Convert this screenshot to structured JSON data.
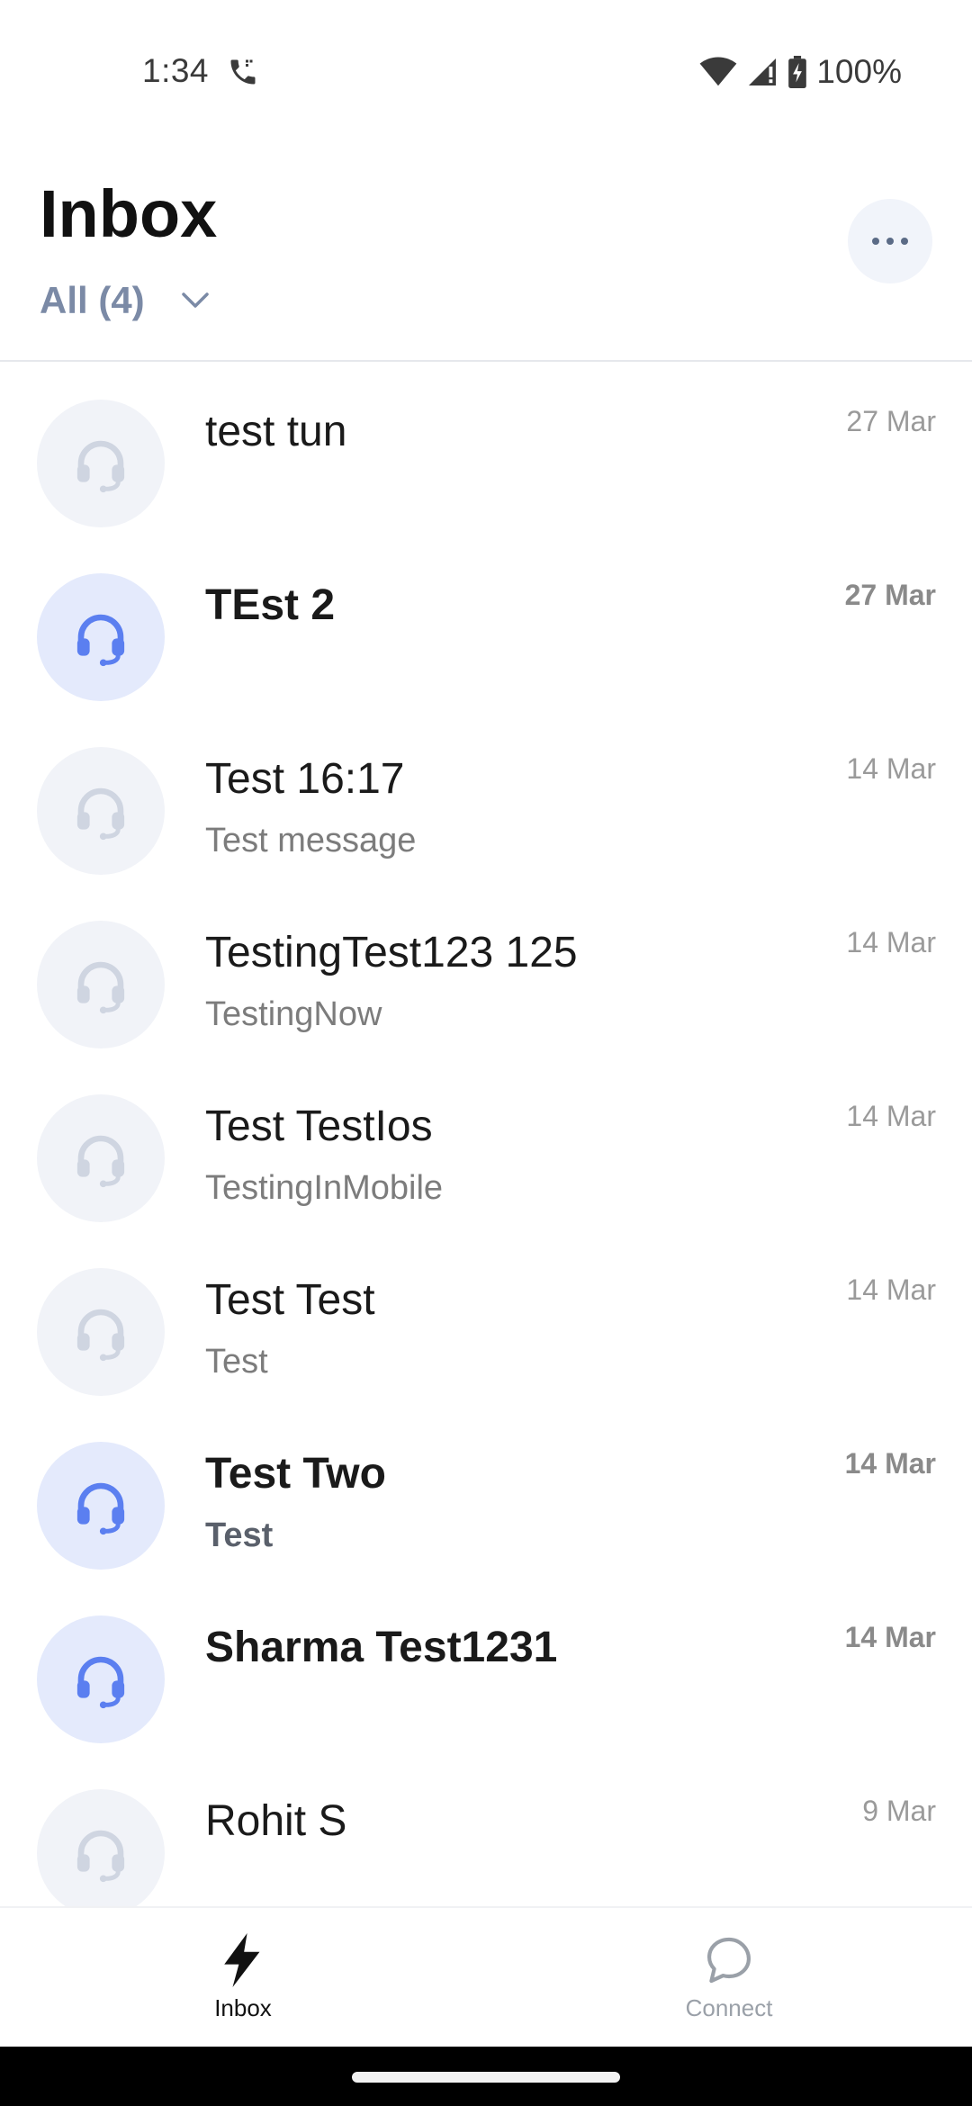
{
  "status_bar": {
    "time": "1:34",
    "battery": "100%"
  },
  "header": {
    "title": "Inbox",
    "filter_label": "All (4)"
  },
  "conversations": [
    {
      "name": "test tun",
      "preview": "",
      "date": "27 Mar",
      "unread": false
    },
    {
      "name": "TEst 2",
      "preview": "",
      "date": "27 Mar",
      "unread": true
    },
    {
      "name": "Test 16:17",
      "preview": "Test message",
      "date": "14 Mar",
      "unread": false
    },
    {
      "name": "TestingTest123 125",
      "preview": "TestingNow",
      "date": "14 Mar",
      "unread": false
    },
    {
      "name": "Test TestIos",
      "preview": "TestingInMobile",
      "date": "14 Mar",
      "unread": false
    },
    {
      "name": "Test Test",
      "preview": "Test",
      "date": "14 Mar",
      "unread": false
    },
    {
      "name": "Test Two",
      "preview": "Test",
      "date": "14 Mar",
      "unread": true
    },
    {
      "name": "Sharma Test1231",
      "preview": "",
      "date": "14 Mar",
      "unread": true
    },
    {
      "name": "Rohit S",
      "preview": "",
      "date": "9 Mar",
      "unread": false
    }
  ],
  "bottom_nav": {
    "inbox_label": "Inbox",
    "connect_label": "Connect"
  },
  "colors": {
    "accent": "#5b7ff0",
    "avatar_active_bg": "#e4eafc",
    "avatar_inactive_bg": "#f1f3f8",
    "icon_inactive": "#cfd5e1",
    "filter_text": "#7b8aa6"
  },
  "icons": {
    "conversation_avatar": "headset-icon",
    "more": "more-horizontal-icon",
    "filter": "chevron-down-icon",
    "nav_inbox": "lightning-bolt-icon",
    "nav_connect": "chat-bubble-icon"
  }
}
